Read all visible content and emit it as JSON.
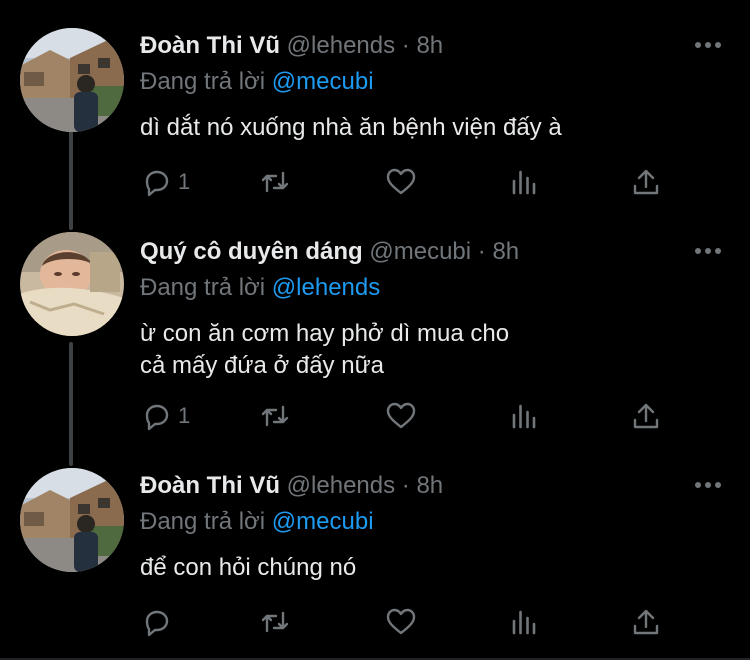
{
  "tweets": [
    {
      "name": "Đoàn Thi Vũ",
      "handle": "@lehends",
      "separator": "·",
      "time": "8h",
      "reply_prefix": "Đang trả lời",
      "reply_to": "@mecubi",
      "text_lines": [
        "dì dắt nó xuống nhà ăn bệnh viện đấy à"
      ],
      "reply_count": "1",
      "avatar": "street-photo-avatar"
    },
    {
      "name": "Quý cô duyên dáng",
      "handle": "@mecubi",
      "separator": "·",
      "time": "8h",
      "reply_prefix": "Đang trả lời",
      "reply_to": "@lehends",
      "text_lines": [
        "ừ con ăn cơm hay phở dì mua cho",
        "cả mấy đứa ở đấy nữa"
      ],
      "reply_count": "1",
      "avatar": "sleeping-child-avatar"
    },
    {
      "name": "Đoàn Thi Vũ",
      "handle": "@lehends",
      "separator": "·",
      "time": "8h",
      "reply_prefix": "Đang trả lời",
      "reply_to": "@mecubi",
      "text_lines": [
        "để con hỏi chúng nó"
      ],
      "reply_count": "",
      "avatar": "street-photo-avatar"
    }
  ],
  "icons": [
    "more-icon",
    "reply-icon",
    "retweet-icon",
    "like-icon",
    "analytics-icon",
    "share-icon"
  ],
  "colors": {
    "background": "#000000",
    "text": "#e7e9ea",
    "secondary": "#71767b",
    "link": "#1d9bf0",
    "thread_line": "#3e4144"
  }
}
